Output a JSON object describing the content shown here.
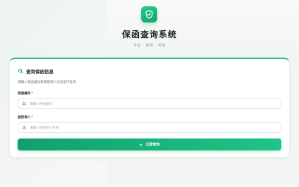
{
  "header": {
    "logo_icon": "shield-check-icon",
    "title": "保函查询系统",
    "subtitle": "专业 · 高效 · 可信"
  },
  "card": {
    "title_icon": "search-icon",
    "title": "查询保函信息",
    "description": "请输入保函编号和被担保人信息进行查询"
  },
  "form": {
    "guarantee_no": {
      "label": "保函编号",
      "required_mark": "*",
      "icon": "hash-icon",
      "placeholder": "请输入保函编号",
      "value": ""
    },
    "guaranteed_party": {
      "label": "被担保人",
      "required_mark": "*",
      "icon": "user-icon",
      "placeholder": "请输入被担保人名称",
      "value": ""
    },
    "submit": {
      "icon": "sparkle-icon",
      "label": "立即查询"
    }
  },
  "colors": {
    "accent": "#1dbb7d",
    "accent_dark": "#12a06a",
    "required": "#e0453b"
  }
}
